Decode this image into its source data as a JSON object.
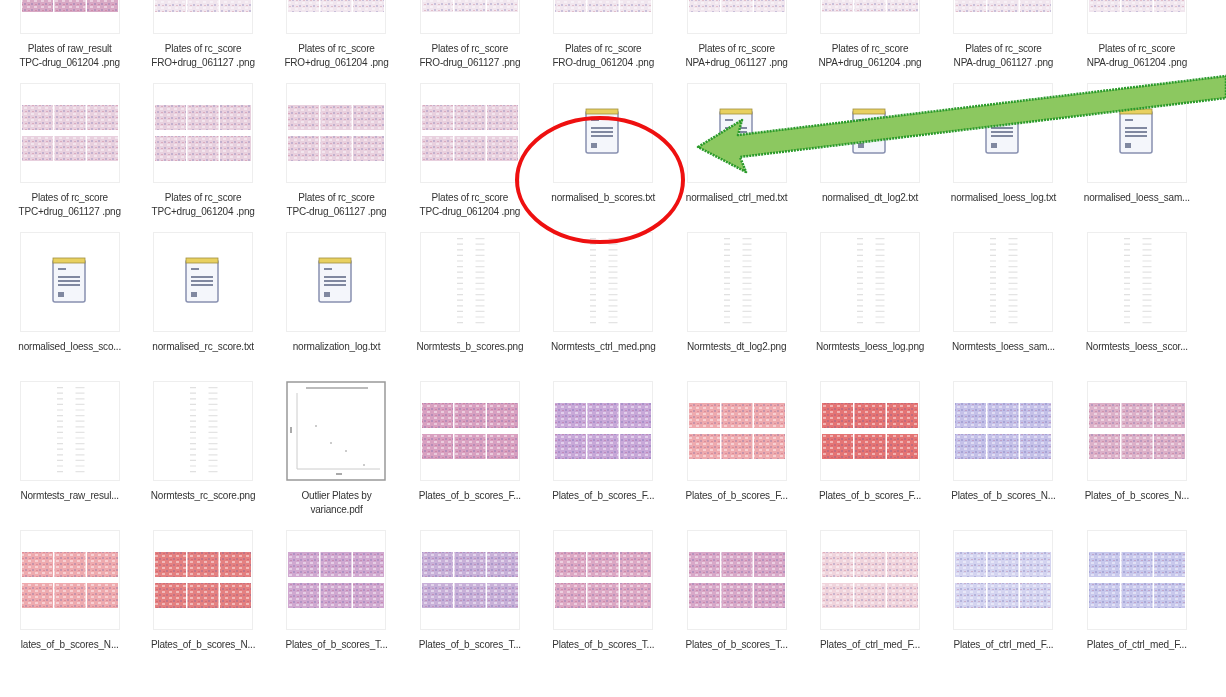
{
  "files": [
    {
      "kind": "heatmap",
      "color": "#d8a8c4",
      "name": "Plates of raw_result TPC-drug_061204 .png"
    },
    {
      "kind": "heatmap",
      "color": "#f1e6ee",
      "name": "Plates of rc_score FRO+drug_061127 .png"
    },
    {
      "kind": "heatmap",
      "color": "#f1e6ee",
      "name": "Plates of rc_score FRO+drug_061204 .png"
    },
    {
      "kind": "heatmap",
      "color": "#f1e6ee",
      "name": "Plates of rc_score FRO-drug_061127 .png"
    },
    {
      "kind": "heatmap",
      "color": "#f1e6ee",
      "name": "Plates of rc_score FRO-drug_061204 .png"
    },
    {
      "kind": "heatmap",
      "color": "#f1e6ee",
      "name": "Plates of rc_score NPA+drug_061127 .png"
    },
    {
      "kind": "heatmap",
      "color": "#f1e6ee",
      "name": "Plates of rc_score NPA+drug_061204 .png"
    },
    {
      "kind": "heatmap",
      "color": "#f1e6ee",
      "name": "Plates of rc_score NPA-drug_061127 .png"
    },
    {
      "kind": "heatmap",
      "color": "#f1e6ee",
      "name": "Plates of rc_score NPA-drug_061204 .png"
    },
    {
      "kind": "heatmap",
      "color": "#e8d0de",
      "name": "Plates of rc_score TPC+drug_061127 .png"
    },
    {
      "kind": "heatmap",
      "color": "#e8d0de",
      "name": "Plates of rc_score TPC+drug_061204 .png"
    },
    {
      "kind": "heatmap",
      "color": "#e8d0de",
      "name": "Plates of rc_score TPC-drug_061127 .png"
    },
    {
      "kind": "heatmap",
      "color": "#e8d0de",
      "name": "Plates of rc_score TPC-drug_061204 .png"
    },
    {
      "kind": "text",
      "name": "normalised_b_scores.txt"
    },
    {
      "kind": "text",
      "name": "normalised_ctrl_med.txt"
    },
    {
      "kind": "text",
      "name": "normalised_dt_log2.txt"
    },
    {
      "kind": "text",
      "name": "normalised_loess_log.txt"
    },
    {
      "kind": "text",
      "name": "normalised_loess_sam..."
    },
    {
      "kind": "text",
      "name": "normalised_loess_sco..."
    },
    {
      "kind": "text",
      "name": "normalised_rc_score.txt"
    },
    {
      "kind": "text",
      "name": "normalization_log.txt"
    },
    {
      "kind": "lineplot",
      "name": "Normtests_b_scores.png"
    },
    {
      "kind": "lineplot",
      "name": "Normtests_ctrl_med.png"
    },
    {
      "kind": "lineplot",
      "name": "Normtests_dt_log2.png"
    },
    {
      "kind": "lineplot",
      "name": "Normtests_loess_log.png"
    },
    {
      "kind": "lineplot",
      "name": "Normtests_loess_sam..."
    },
    {
      "kind": "lineplot",
      "name": "Normtests_loess_scor..."
    },
    {
      "kind": "lineplot",
      "name": "Normtests_raw_resul..."
    },
    {
      "kind": "lineplot",
      "name": "Normtests_rc_score.png"
    },
    {
      "kind": "scatter",
      "name": "Outlier Plates by variance.pdf"
    },
    {
      "kind": "heatmap",
      "color": "#d8a0c0",
      "name": "Plates_of_b_scores_F..."
    },
    {
      "kind": "heatmap",
      "color": "#c8a8d8",
      "name": "Plates_of_b_scores_F..."
    },
    {
      "kind": "heatmap",
      "color": "#eeaaae",
      "name": "Plates_of_b_scores_F..."
    },
    {
      "kind": "heatmap",
      "color": "#e47474",
      "name": "Plates_of_b_scores_F..."
    },
    {
      "kind": "heatmap",
      "color": "#c4c0e8",
      "name": "Plates_of_b_scores_N..."
    },
    {
      "kind": "heatmap",
      "color": "#dcb0c8",
      "name": "Plates_of_b_scores_N..."
    },
    {
      "kind": "heatmap",
      "color": "#eeaaae",
      "name": "lates_of_b_scores_N..."
    },
    {
      "kind": "heatmap",
      "color": "#e48080",
      "name": "Plates_of_b_scores_N..."
    },
    {
      "kind": "heatmap",
      "color": "#d0a8d0",
      "name": "Plates_of_b_scores_T..."
    },
    {
      "kind": "heatmap",
      "color": "#c8b0d8",
      "name": "Plates_of_b_scores_T..."
    },
    {
      "kind": "heatmap",
      "color": "#dca8c4",
      "name": "Plates_of_b_scores_T..."
    },
    {
      "kind": "heatmap",
      "color": "#d8a8c8",
      "name": "Plates_of_b_scores_T..."
    },
    {
      "kind": "heatmap",
      "color": "#f0d4dc",
      "name": "Plates_of_ctrl_med_F..."
    },
    {
      "kind": "heatmap",
      "color": "#d4d4f0",
      "name": "Plates_of_ctrl_med_F..."
    },
    {
      "kind": "heatmap",
      "color": "#c8c8ec",
      "name": "Plates_of_ctrl_med_F..."
    }
  ],
  "annotations": {
    "circle": true,
    "arrow": true
  }
}
